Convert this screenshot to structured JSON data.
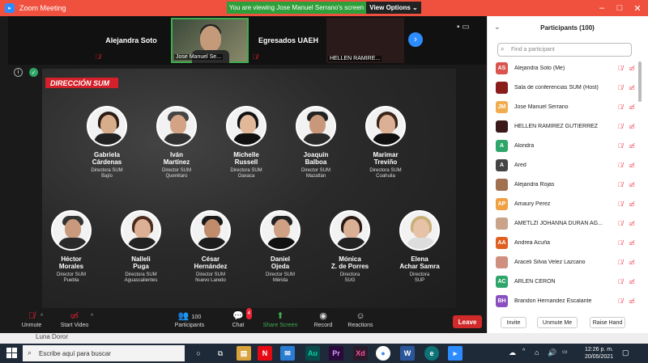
{
  "window": {
    "title": "Zoom Meeting",
    "banner_text": "You are viewing Jose Manuel Serrano's screen",
    "view_options": "View Options ⌄"
  },
  "strip": {
    "tiles": [
      {
        "label": "Alejandra Soto"
      },
      {
        "label": "Jose Manuel Se..."
      },
      {
        "label": "Egresados UAEH"
      },
      {
        "label": "HELLEN RAMIRE..."
      }
    ]
  },
  "slide": {
    "title": "DIRECCIÓN SUM",
    "people": [
      {
        "name": "Gabriela\nCárdenas",
        "role": "Directora SUM\nBajío"
      },
      {
        "name": "Iván\nMartínez",
        "role": "Director SUM\nQuerétaro"
      },
      {
        "name": "Michelle\nRussell",
        "role": "Directora SUM\nOaxaca"
      },
      {
        "name": "Joaquín\nBalboa",
        "role": "Director SUM\nMazatlán"
      },
      {
        "name": "Marimar\nTreviño",
        "role": "Directora SUM\nCoahuila"
      },
      {
        "name": "Héctor\nMorales",
        "role": "Director SUM\nPuebla"
      },
      {
        "name": "Nalleli\nPuga",
        "role": "Directora SUM\nAguascalientes"
      },
      {
        "name": "César\nHernández",
        "role": "Director SUM\nNuevo Laredo"
      },
      {
        "name": "Daniel\nOjeda",
        "role": "Director SUM\nMérida"
      },
      {
        "name": "Mónica\nZ. de Porres",
        "role": "Directora\nSUG"
      },
      {
        "name": "Elena\nAchar Samra",
        "role": "Directora\nSUP"
      }
    ]
  },
  "toolbar": {
    "unmute": "Unmute",
    "start_video": "Start Video",
    "participants": "Participants",
    "participants_count": "100",
    "chat": "Chat",
    "chat_badge": "4",
    "share_screen": "Share Screen",
    "record": "Record",
    "reactions": "Reactions",
    "leave": "Leave"
  },
  "panel": {
    "title": "Participants (100)",
    "search_placeholder": "Find a participant",
    "participants": [
      {
        "initials": "AS",
        "name": "Alejandra Soto (Me)",
        "color": "#d9534f"
      },
      {
        "initials": "",
        "name": "Sala de conferencias SUM (Host)",
        "color": "#8a1c1c"
      },
      {
        "initials": "JM",
        "name": "Jose Manuel Serrano",
        "color": "#f0ad4e"
      },
      {
        "initials": "",
        "name": "HELLEN RAMIREZ GUTIERREZ",
        "color": "#3a1a1a"
      },
      {
        "initials": "A",
        "name": "Alondra",
        "color": "#2ea66a"
      },
      {
        "initials": "A",
        "name": "Ared",
        "color": "#444444"
      },
      {
        "initials": "",
        "name": "Alejandra Rojas",
        "color": "#a07050"
      },
      {
        "initials": "AP",
        "name": "Amaury Perez",
        "color": "#f0a040"
      },
      {
        "initials": "",
        "name": "AMETLZI JOHANNA DURAN AG...",
        "color": "#c9a48a"
      },
      {
        "initials": "AA",
        "name": "Andrea Acuña",
        "color": "#e06020"
      },
      {
        "initials": "",
        "name": "Araceli Silvia Velez Lazcano",
        "color": "#d09080"
      },
      {
        "initials": "AC",
        "name": "ARLEN CERON",
        "color": "#2ea66a"
      },
      {
        "initials": "BH",
        "name": "Brandon Hernandez Escalante",
        "color": "#8a4fbf"
      }
    ],
    "invite": "Invite",
    "unmute_me": "Unmute Me",
    "raise_hand": "Raise Hand"
  },
  "underlay": {
    "text": "Luna Doror"
  },
  "taskbar": {
    "search_placeholder": "Escribe aquí para buscar",
    "time": "12:26 p. m.",
    "date": "20/05/2021"
  },
  "icons": {
    "zoom_logo": "zoom-logo",
    "mic_muted": "mic-muted-icon",
    "video_off": "video-off-icon"
  }
}
